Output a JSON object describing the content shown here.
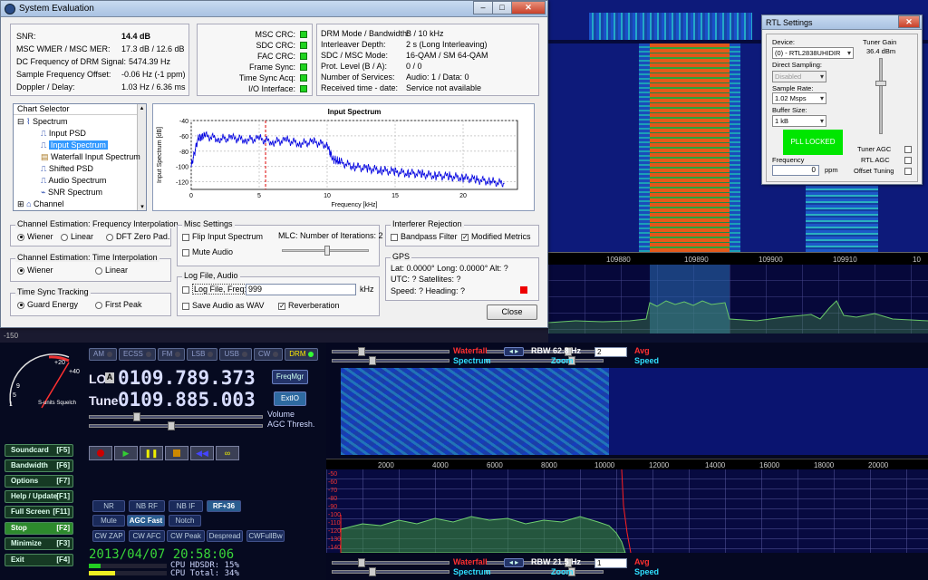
{
  "sysEval": {
    "title": "System Evaluation",
    "snr_label": "SNR:",
    "snr_value": "14.4 dB",
    "mer_label": "MSC WMER / MSC MER:",
    "mer_value": "17.3 dB / 12.6 dB",
    "dcfreq_label": "DC Frequency of DRM Signal:",
    "dcfreq_value": "5474.39 Hz",
    "sfo_label": "Sample Frequency Offset:",
    "sfo_value": "-0.06 Hz (-1 ppm)",
    "doppler_label": "Doppler / Delay:",
    "doppler_value": "1.03 Hz / 6.36 ms",
    "crc": [
      "MSC CRC:",
      "SDC CRC:",
      "FAC CRC:",
      "Frame Sync:",
      "Time Sync Acq:",
      "I/O Interface:"
    ],
    "drm_rows": [
      {
        "label": "DRM Mode / Bandwidth:",
        "value": "B / 10 kHz"
      },
      {
        "label": "Interleaver Depth:",
        "value": "2 s (Long Interleaving)"
      },
      {
        "label": "SDC / MSC Mode:",
        "value": "16-QAM / SM 64-QAM"
      },
      {
        "label": "Prot. Level (B / A):",
        "value": "0 / 0"
      },
      {
        "label": "Number of Services:",
        "value": "Audio: 1 / Data: 0"
      },
      {
        "label": "Received time - date:",
        "value": "Service not available"
      }
    ],
    "chart_selector": {
      "header": "Chart Selector",
      "root": "Spectrum",
      "items": [
        "Input PSD",
        "Input Spectrum",
        "Waterfall Input Spectrum",
        "Shifted PSD",
        "Audio Spectrum",
        "SNR Spectrum"
      ],
      "channel": "Channel"
    },
    "freq_interp": {
      "title": "Channel Estimation: Frequency Interpolation",
      "options": [
        "Wiener",
        "Linear",
        "DFT Zero Pad."
      ]
    },
    "time_interp": {
      "title": "Channel Estimation: Time Interpolation",
      "options": [
        "Wiener",
        "Linear"
      ]
    },
    "time_sync": {
      "title": "Time Sync Tracking",
      "options": [
        "Guard Energy",
        "First Peak"
      ]
    },
    "misc": {
      "title": "Misc Settings",
      "flip": "Flip Input Spectrum",
      "mute": "Mute Audio",
      "mlc": "MLC: Number of Iterations: 2"
    },
    "logfile": {
      "title": "Log File, Audio",
      "log_label": "Log File, Freq:",
      "freq_value": "999",
      "unit": "kHz",
      "wav": "Save Audio as WAV",
      "reverb": "Reverberation"
    },
    "interferer": {
      "title": "Interferer Rejection",
      "bandpass": "Bandpass Filter",
      "metrics": "Modified Metrics"
    },
    "gps": {
      "title": "GPS",
      "line1": "Lat: 0.0000°   Long: 0.0000°    Alt: ?",
      "line2": "UTC: ?  Satellites: ?",
      "line3": "Speed: ?  Heading: ?"
    },
    "close": "Close"
  },
  "rtl": {
    "title": "RTL Settings",
    "device_label": "Device:",
    "device_value": "(0) - RTL2838UHIDIR",
    "direct_label": "Direct Sampling:",
    "direct_value": "Disabled",
    "rate_label": "Sample Rate:",
    "rate_value": "1.02 Msps",
    "buffer_label": "Buffer Size:",
    "buffer_value": "1 kB",
    "pll": "PLL LOCKED",
    "freq_label": "Frequency",
    "freq_value": "0",
    "ppm": "ppm",
    "gain_label": "Tuner Gain",
    "gain_value": "36.4  dBm",
    "tuner_agc": "Tuner AGC",
    "rtl_agc": "RTL AGC",
    "offset": "Offset Tuning"
  },
  "hdsdr": {
    "modes": [
      "AM",
      "ECSS",
      "FM",
      "LSB",
      "USB",
      "CW",
      "DRM"
    ],
    "lo_label": "LO",
    "lo_value": "0109.789.373",
    "tune_label": "Tune",
    "tune_value": "0109.885.003",
    "freqmgr": "FreqMgr",
    "extio": "ExtIO",
    "volume": "Volume",
    "agc_thresh": "AGC Thresh.",
    "squelch": "S-units Squelch",
    "left_buttons": [
      {
        "label": "Soundcard",
        "key": "[F5]"
      },
      {
        "label": "Bandwidth",
        "key": "[F6]"
      },
      {
        "label": "Options",
        "key": "[F7]"
      },
      {
        "label": "Help / Update",
        "key": "[F1]"
      },
      {
        "label": "Full Screen",
        "key": "[F11]"
      },
      {
        "label": "Stop",
        "key": "[F2]"
      },
      {
        "label": "Minimize",
        "key": "[F3]"
      },
      {
        "label": "Exit",
        "key": "[F4]"
      }
    ],
    "filters1": [
      "NR",
      "NB RF",
      "NB IF",
      "RF+36"
    ],
    "filters2": [
      "Mute",
      "AGC Fast",
      "Notch"
    ],
    "filters3": [
      "CW ZAP",
      "CW AFC",
      "CW Peak",
      "Despread",
      "CWFullBw"
    ],
    "datetime": "2013/04/07 20:58:06",
    "cpu_hdsdr": "CPU HDSDR: 15%",
    "cpu_total": "CPU Total:  34%",
    "cpu_hdsdr_pct": 15,
    "cpu_total_pct": 34,
    "waterfall": "Waterfall",
    "spectrum": "Spectrum",
    "rbw_top": "RBW 62.8 Hz",
    "rbw_bottom": "RBW 21.5 Hz",
    "avg_top": "2",
    "avg_bottom": "1",
    "zoom": "Zoom",
    "avg": "Avg",
    "speed": "Speed",
    "top_freq_ticks": [
      "109880",
      "109890",
      "109900",
      "109910",
      "10"
    ],
    "low_freq_ticks": [
      "2000",
      "4000",
      "6000",
      "8000",
      "10000",
      "12000",
      "14000",
      "16000",
      "18000",
      "20000"
    ],
    "db_ticks": [
      "-50",
      "-60",
      "-70",
      "-80",
      "-90",
      "-100",
      "-110",
      "-120",
      "-130",
      "-140"
    ],
    "strip": "-150"
  },
  "chart_data": {
    "type": "line",
    "title": "Input Spectrum",
    "xlabel": "Frequency [kHz]",
    "ylabel": "Input Spectrum [dB]",
    "xlim": [
      0,
      24
    ],
    "ylim": [
      -130,
      -40
    ],
    "xticks": [
      "0",
      "5",
      "10",
      "15",
      "20"
    ],
    "yticks": [
      "-40",
      "-60",
      "-80",
      "-100",
      "-120"
    ],
    "series": [
      {
        "x": [
          0,
          0.5,
          1,
          2,
          3,
          4,
          5,
          6,
          7,
          8,
          9,
          10,
          10.4,
          11,
          12,
          13,
          14,
          15,
          16,
          17,
          18,
          19,
          20,
          21,
          22,
          23
        ],
        "values": [
          -100,
          -63,
          -60,
          -64,
          -63,
          -65,
          -64,
          -68,
          -66,
          -70,
          -68,
          -72,
          -90,
          -95,
          -100,
          -103,
          -105,
          -107,
          -109,
          -110,
          -112,
          -113,
          -115,
          -117,
          -120,
          -122
        ]
      }
    ]
  }
}
